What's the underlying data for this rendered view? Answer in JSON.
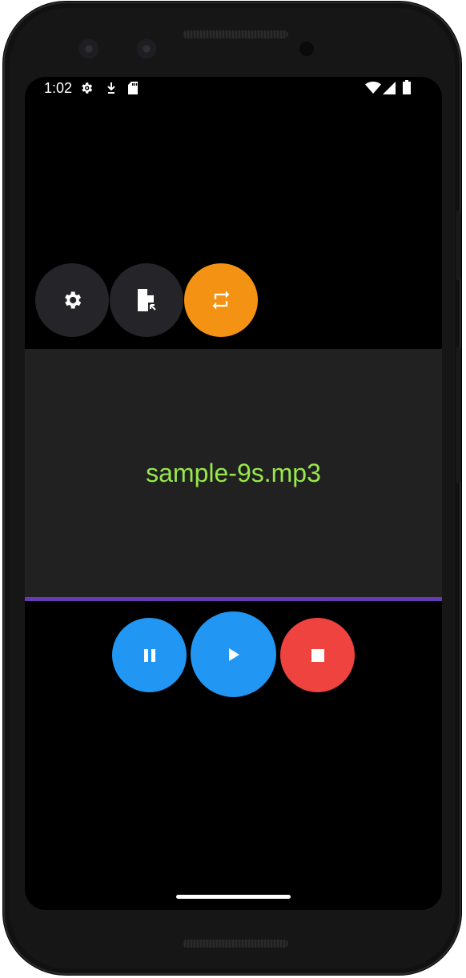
{
  "status_bar": {
    "time": "1:02",
    "icons": [
      "settings-icon",
      "download-icon",
      "sd-card-icon",
      "wifi-icon",
      "cell-signal-icon",
      "battery-icon"
    ]
  },
  "toolbar": {
    "settings_icon": "gear-icon",
    "open_file_icon": "file-open-icon",
    "repeat_icon": "repeat-icon",
    "repeat_active": true
  },
  "now_playing": {
    "track_name": "sample-9s.mp3"
  },
  "controls": {
    "pause_icon": "pause-icon",
    "play_icon": "play-icon",
    "stop_icon": "stop-icon"
  },
  "colors": {
    "button_dark": "#252428",
    "accent_orange": "#f39213",
    "track_text": "#96e84b",
    "panel_bg": "#212121",
    "progress": "#673ab7",
    "blue": "#2196f3",
    "red": "#ef4340"
  }
}
